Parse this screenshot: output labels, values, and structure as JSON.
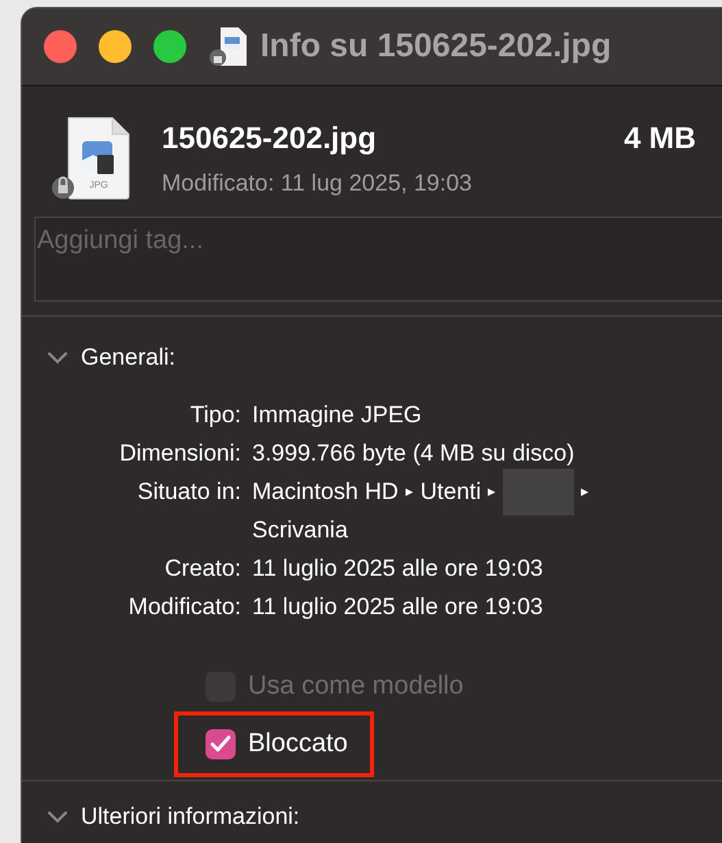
{
  "window": {
    "title": "Info su 150625-202.jpg",
    "traffic_lights": [
      {
        "color": "#fe5f57"
      },
      {
        "color": "#febc2e"
      },
      {
        "color": "#28c840"
      }
    ]
  },
  "file": {
    "name": "150625-202.jpg",
    "size": "4 MB",
    "modified": "Modificato: 11 lug 2025, 19:03",
    "icon_label": "JPG",
    "locked": true
  },
  "tags": {
    "placeholder": "Aggiungi tag..."
  },
  "general": {
    "title": "Generali:",
    "expanded": true,
    "rows": [
      {
        "label": "Tipo:",
        "value": "Immagine JPEG"
      },
      {
        "label": "Dimensioni:",
        "value": "3.999.766 byte (4 MB su disco)"
      },
      {
        "label": "Situato in:",
        "path": [
          {
            "kind": "text",
            "text": "Macintosh HD"
          },
          {
            "kind": "separator",
            "text": "▸"
          },
          {
            "kind": "text",
            "text": "Utenti"
          },
          {
            "kind": "separator",
            "text": "▸"
          },
          {
            "kind": "redacted"
          },
          {
            "kind": "separator",
            "text": "▸"
          },
          {
            "kind": "text",
            "text": "Scrivania"
          }
        ]
      },
      {
        "label": "Creato:",
        "value": "11 luglio 2025 alle ore 19:03"
      },
      {
        "label": "Modificato:",
        "value": "11 luglio 2025 alle ore 19:03"
      }
    ],
    "checkboxes": [
      {
        "label": "Usa come modello",
        "checked": false,
        "disabled": true,
        "highlighted": false
      },
      {
        "label": "Bloccato",
        "checked": true,
        "disabled": false,
        "highlighted": true
      }
    ]
  },
  "more_info": {
    "title": "Ulteriori informazioni:",
    "expanded": true
  }
}
